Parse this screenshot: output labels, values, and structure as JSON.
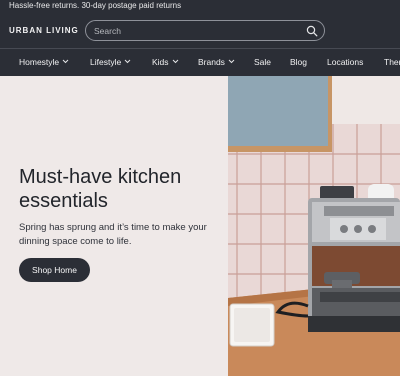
{
  "announcement": {
    "text": "Hassle-free returns. 30-day postage paid returns"
  },
  "header": {
    "brand": "URBAN LIVING",
    "search": {
      "placeholder": "Search",
      "value": ""
    },
    "icon": "search-icon"
  },
  "nav": {
    "items": [
      {
        "label": "Homestyle",
        "dropdown": true
      },
      {
        "label": "Lifestyle",
        "dropdown": true
      },
      {
        "label": "Kids",
        "dropdown": true
      },
      {
        "label": "Brands",
        "dropdown": true
      },
      {
        "label": "Sale",
        "dropdown": false
      },
      {
        "label": "Blog",
        "dropdown": false
      },
      {
        "label": "Locations",
        "dropdown": false
      },
      {
        "label": "Theme",
        "dropdown": false
      }
    ]
  },
  "hero": {
    "title": "Must-have kitchen essentials",
    "subtitle": "Spring has sprung and it’s time to make your dinning space come to life.",
    "cta": "Shop Home",
    "image": "kitchen-espresso-machine"
  },
  "colors": {
    "header_bg": "#2b2e36",
    "hero_bg": "#efe9e8",
    "button_bg": "#2b2e36"
  }
}
